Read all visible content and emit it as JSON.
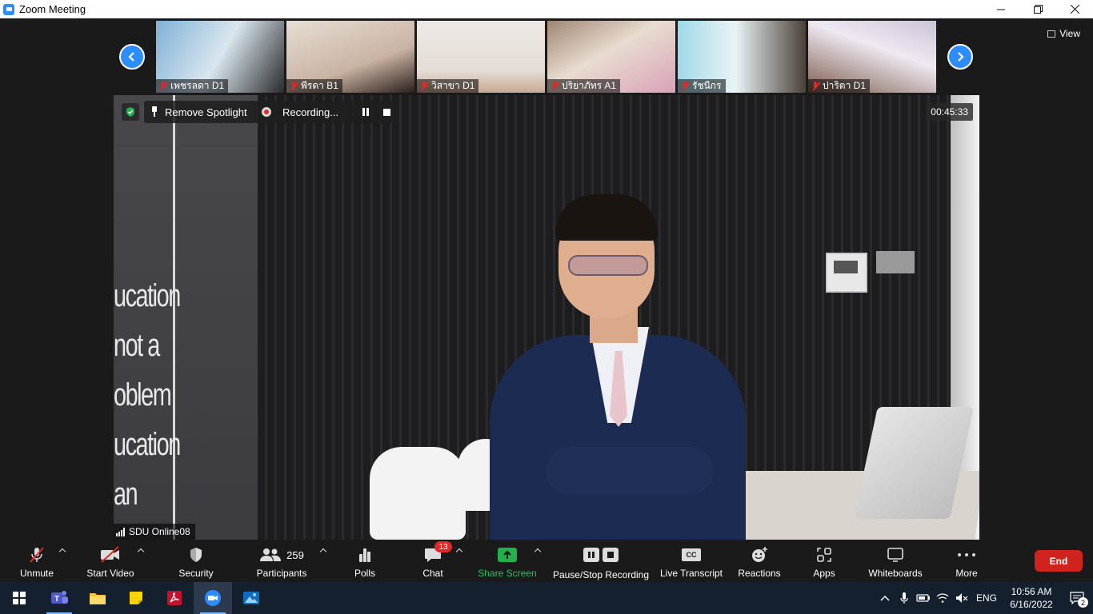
{
  "window": {
    "title": "Zoom Meeting",
    "controls": [
      "minimize",
      "restore",
      "close"
    ]
  },
  "gallery": {
    "view_label": "View",
    "participants": [
      {
        "name": "เพชรลดา D1",
        "muted": true
      },
      {
        "name": "พีรดา B1",
        "muted": true
      },
      {
        "name": "วิสาขา D1",
        "muted": true
      },
      {
        "name": "ปริยาภัทร A1",
        "muted": true
      },
      {
        "name": "รัชนีกร",
        "muted": true
      },
      {
        "name": "ปาริตา D1",
        "muted": true
      }
    ]
  },
  "main_video": {
    "spotlight_label": "Remove Spotlight",
    "recording_label": "Recording...",
    "elapsed": "00:45:33",
    "speaker_name": "SDU Online08",
    "wall_text": [
      "ucation",
      "not a",
      "oblem",
      "ucation",
      "an"
    ]
  },
  "toolbar": {
    "unmute": "Unmute",
    "start_video": "Start Video",
    "security": "Security",
    "participants_label": "Participants",
    "participants_count": "259",
    "polls": "Polls",
    "chat": "Chat",
    "chat_unread": "13",
    "share_screen": "Share Screen",
    "pause_stop_recording": "Pause/Stop Recording",
    "cc_glyph": "CC",
    "live_transcript": "Live Transcript",
    "reactions": "Reactions",
    "apps": "Apps",
    "whiteboards": "Whiteboards",
    "more": "More",
    "end": "End"
  },
  "taskbar": {
    "apps": [
      "start",
      "teams",
      "file-explorer",
      "sticky-notes",
      "acrobat",
      "zoom",
      "photos"
    ],
    "language": "ENG",
    "time": "10:56 AM",
    "date": "6/16/2022",
    "notification_count": "2"
  },
  "colors": {
    "accent_blue": "#2d8cff",
    "share_green": "#22b14c",
    "end_red": "#d0231d",
    "muted_red": "#e02828",
    "taskbar": "#15202f"
  }
}
